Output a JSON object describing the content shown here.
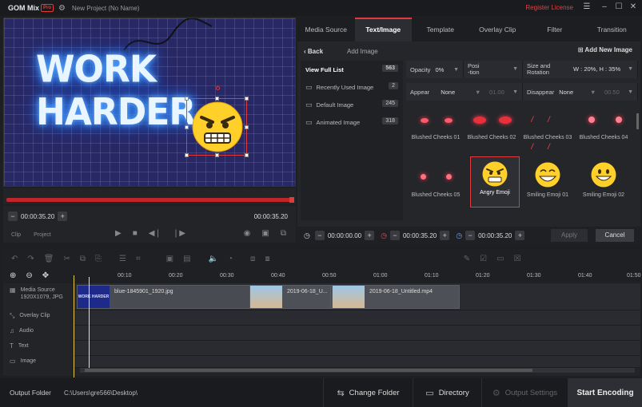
{
  "app": {
    "logo": "GOM Mix",
    "pro_badge": "Pro",
    "project_title": "New Project (No Name)",
    "register": "Register License"
  },
  "preview": {
    "neon_text": "WORK HARDER"
  },
  "player": {
    "current_time": "00:00:35.20",
    "end_time": "00:00:35.20",
    "tab_clip": "Clip",
    "tab_project": "Project"
  },
  "tabs": [
    {
      "label": "Media Source"
    },
    {
      "label": "Text/Image"
    },
    {
      "label": "Template"
    },
    {
      "label": "Overlay Clip"
    },
    {
      "label": "Filter"
    },
    {
      "label": "Transition"
    }
  ],
  "image_panel": {
    "back": "Back",
    "title": "Add Image",
    "add_new": "Add New Image",
    "lists": [
      {
        "label": "View Full List",
        "count": "563"
      },
      {
        "label": "Recently Used Image",
        "count": "2"
      },
      {
        "label": "Default Image",
        "count": "245"
      },
      {
        "label": "Animated Image",
        "count": "318"
      }
    ],
    "props": {
      "opacity_label": "Opacity",
      "opacity_value": "0%",
      "position_label": "Posi\n-tion",
      "size_label": "Size and Rotation",
      "size_value": "W : 20%, H : 35%",
      "appear_label": "Appear",
      "appear_value": "None",
      "appear_time": "01.00",
      "disappear_label": "Disappear",
      "disappear_value": "None",
      "disappear_time": "00.50"
    },
    "thumbnails": [
      {
        "label": "Blushed Cheeks 01"
      },
      {
        "label": "Blushed Cheeks 02"
      },
      {
        "label": "Blushed Cheeks 03"
      },
      {
        "label": "Blushed Cheeks 04"
      },
      {
        "label": "Blushed Cheeks 05"
      },
      {
        "label": "Angry Emoji"
      },
      {
        "label": "Smiling Emoji 01"
      },
      {
        "label": "Smiling Emoji 02"
      }
    ],
    "time_start": "00:00:00.00",
    "time_mid": "00:00:35.20",
    "time_end": "00:00:35.20",
    "apply": "Apply",
    "cancel": "Cancel"
  },
  "timeline": {
    "ticks": [
      "00:10",
      "00:20",
      "00:30",
      "00:40",
      "00:50",
      "01:00",
      "01:10",
      "01:20",
      "01:30",
      "01:40",
      "01:50"
    ],
    "tracks": [
      {
        "label": "Media Source",
        "sub": "1920X1079, JPG"
      },
      {
        "label": "Overlay Clip"
      },
      {
        "label": "Audio"
      },
      {
        "label": "Text"
      },
      {
        "label": "Image"
      }
    ],
    "clips": [
      {
        "name": "blue-1845901_1920.jpg"
      },
      {
        "name": "2019-06-18_U..."
      },
      {
        "name": "2019-06-18_Untitled.mp4"
      }
    ],
    "clip_thumb_text": "WORK HARDER"
  },
  "footer": {
    "output_label": "Output Folder",
    "path": "C:\\Users\\gre566\\Desktop\\",
    "change_folder": "Change Folder",
    "directory": "Directory",
    "output_settings": "Output Settings",
    "start_encoding": "Start Encoding"
  }
}
